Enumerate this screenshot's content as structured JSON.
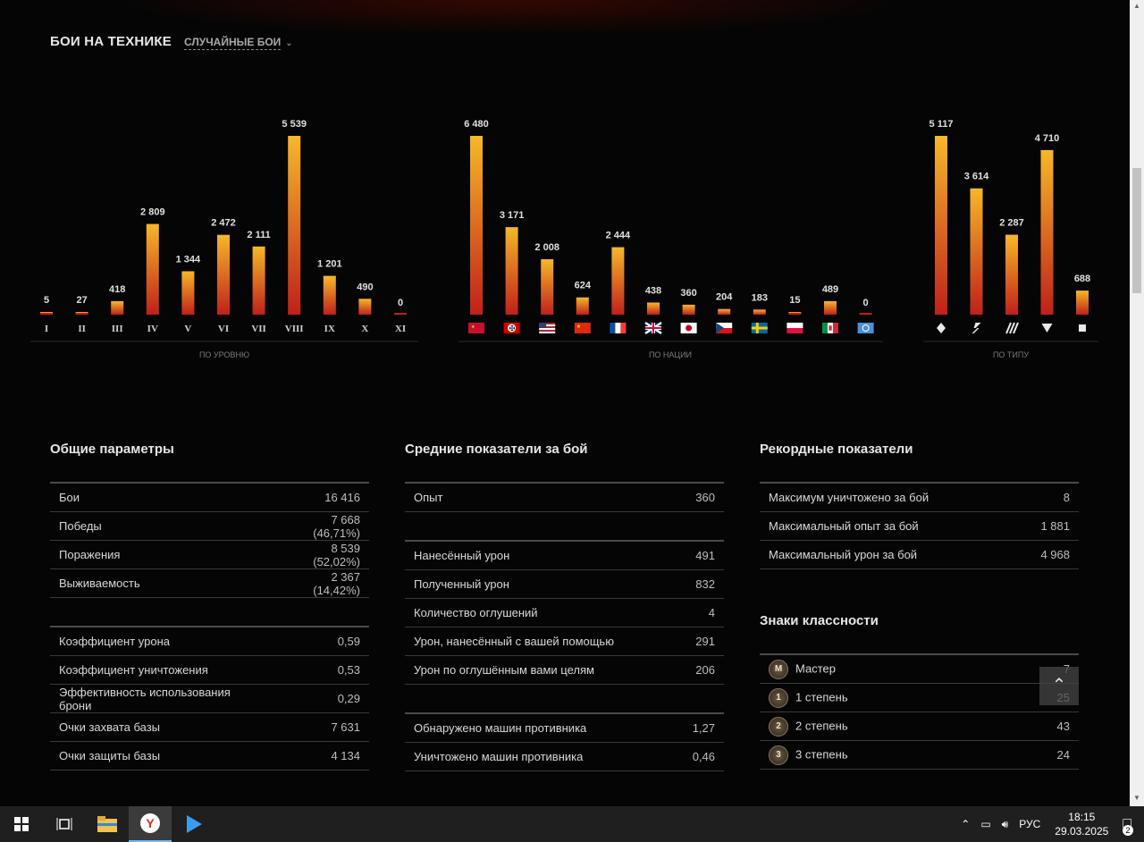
{
  "header": {
    "title": "БОИ НА ТЕХНИКЕ",
    "mode": "СЛУЧАЙНЫЕ БОИ"
  },
  "chart_data": [
    {
      "type": "bar",
      "xlabel": "ПО УРОВНЮ",
      "categories": [
        "I",
        "II",
        "III",
        "IV",
        "V",
        "VI",
        "VII",
        "VIII",
        "IX",
        "X",
        "XI"
      ],
      "values": [
        5,
        27,
        418,
        2809,
        1344,
        2472,
        2111,
        5539,
        1201,
        490,
        0
      ],
      "labels": [
        "5",
        "27",
        "418",
        "2 809",
        "1 344",
        "2 472",
        "2 111",
        "5 539",
        "1 201",
        "490",
        "0"
      ]
    },
    {
      "type": "bar",
      "xlabel": "ПО НАЦИИ",
      "categories": [
        "ussr",
        "germany",
        "usa",
        "china",
        "france",
        "uk",
        "japan",
        "czech",
        "sweden",
        "poland",
        "italy",
        "intunion"
      ],
      "values": [
        6480,
        3171,
        2008,
        624,
        2444,
        438,
        360,
        204,
        183,
        15,
        489,
        0
      ],
      "labels": [
        "6 480",
        "3 171",
        "2 008",
        "624",
        "2 444",
        "438",
        "360",
        "204",
        "183",
        "15",
        "489",
        "0"
      ]
    },
    {
      "type": "bar",
      "xlabel": "ПО ТИПУ",
      "categories": [
        "lightTank",
        "mediumTank",
        "heavyTank",
        "AT-SPG",
        "SPG"
      ],
      "values": [
        5117,
        3614,
        2287,
        4710,
        688
      ],
      "labels": [
        "5 117",
        "3 614",
        "2 287",
        "4 710",
        "688"
      ]
    }
  ],
  "general": {
    "title": "Общие параметры",
    "rows": [
      {
        "k": "Бои",
        "v": "16 416"
      },
      {
        "k": "Победы",
        "v": "7 668 (46,71%)"
      },
      {
        "k": "Поражения",
        "v": "8 539 (52,02%)"
      },
      {
        "k": "Выживаемость",
        "v": "2 367 (14,42%)"
      },
      {
        "k": "",
        "v": ""
      },
      {
        "k": "Коэффициент урона",
        "v": "0,59"
      },
      {
        "k": "Коэффициент уничтожения",
        "v": "0,53"
      },
      {
        "k": "Эффективность использования брони",
        "v": "0,29"
      },
      {
        "k": "Очки захвата базы",
        "v": "7 631"
      },
      {
        "k": "Очки защиты базы",
        "v": "4 134"
      }
    ]
  },
  "average": {
    "title": "Средние показатели за бой",
    "rows": [
      {
        "k": "Опыт",
        "v": "360"
      },
      {
        "k": "",
        "v": ""
      },
      {
        "k": "Нанесённый урон",
        "v": "491"
      },
      {
        "k": "Полученный урон",
        "v": "832"
      },
      {
        "k": "Количество оглушений",
        "v": "4"
      },
      {
        "k": "Урон, нанесённый с вашей помощью",
        "v": "291"
      },
      {
        "k": "Урон по оглушённым вами целям",
        "v": "206"
      },
      {
        "k": "",
        "v": ""
      },
      {
        "k": "Обнаружено машин противника",
        "v": "1,27"
      },
      {
        "k": "Уничтожено машин противника",
        "v": "0,46"
      }
    ]
  },
  "records": {
    "title": "Рекордные показатели",
    "rows": [
      {
        "k": "Максимум уничтожено за бой",
        "v": "8"
      },
      {
        "k": "Максимальный опыт за бой",
        "v": "1 881"
      },
      {
        "k": "Максимальный урон за бой",
        "v": "4 968"
      }
    ]
  },
  "marks": {
    "title": "Знаки классности",
    "rows": [
      {
        "badge": "M",
        "k": "Мастер",
        "v": "7"
      },
      {
        "badge": "1",
        "k": "1 степень",
        "v": "25"
      },
      {
        "badge": "2",
        "k": "2 степень",
        "v": "43"
      },
      {
        "badge": "3",
        "k": "3 степень",
        "v": "24"
      }
    ]
  },
  "taskbar": {
    "lang": "РУС",
    "time": "18:15",
    "date": "29.03.2025",
    "notifications": "2"
  },
  "colors": {
    "bar_top": "#f6b829",
    "bar_bottom": "#c0201a",
    "bg": "#050505"
  }
}
